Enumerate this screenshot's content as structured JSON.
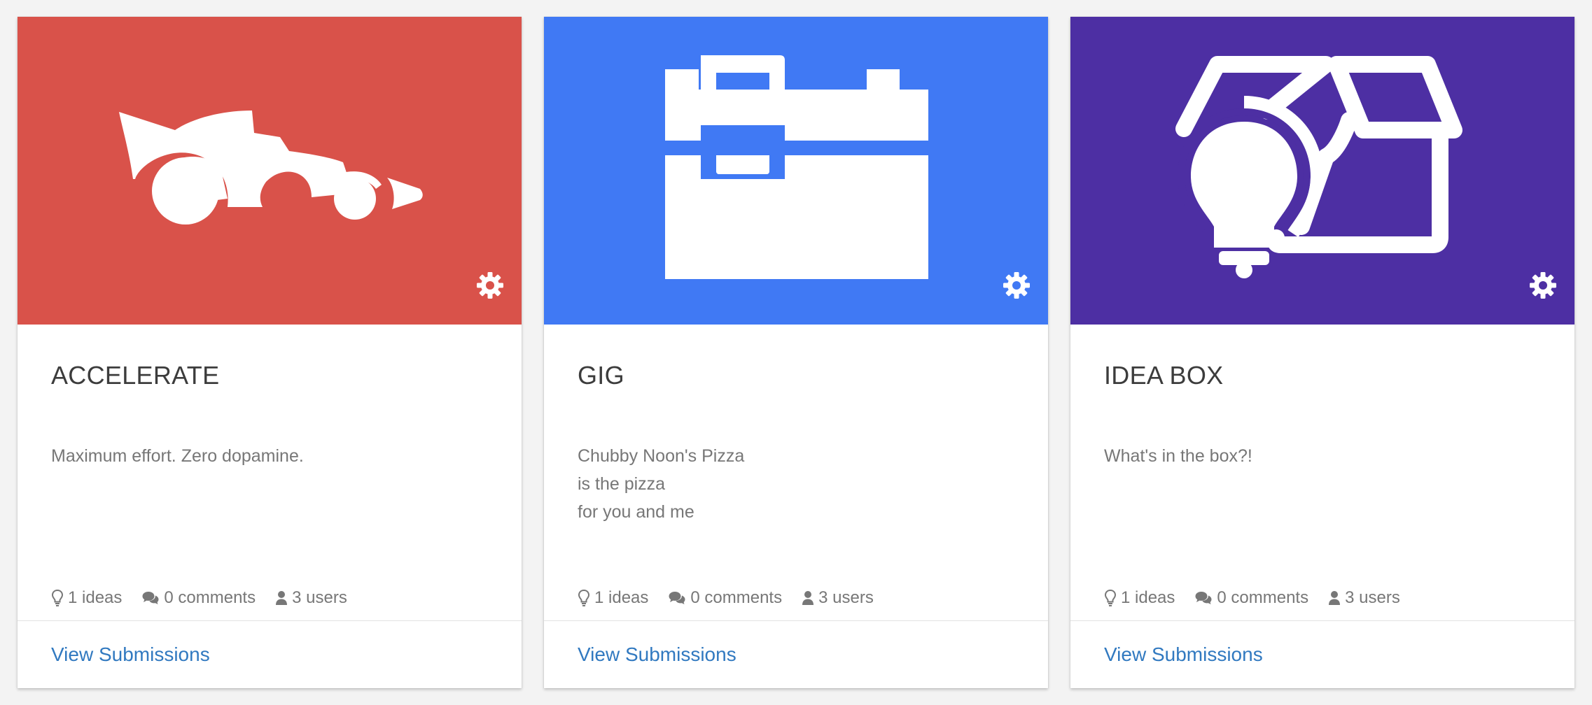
{
  "cards": [
    {
      "title": "ACCELERATE",
      "description": "Maximum effort. Zero dopamine.",
      "ideas": "1 ideas",
      "comments": "0 comments",
      "users": "3 users",
      "link": "View Submissions",
      "banner_color": "#d9524a",
      "banner_icon": "race-car-icon"
    },
    {
      "title": "GIG",
      "description": "Chubby Noon's Pizza\nis the pizza\nfor you and me",
      "ideas": "1 ideas",
      "comments": "0 comments",
      "users": "3 users",
      "link": "View Submissions",
      "banner_color": "#4079f4",
      "banner_icon": "toolbox-icon"
    },
    {
      "title": "IDEA BOX",
      "description": "What's in the box?!",
      "ideas": "1 ideas",
      "comments": "0 comments",
      "users": "3 users",
      "link": "View Submissions",
      "banner_color": "#4d2fa3",
      "banner_icon": "lightbulb-box-icon"
    }
  ],
  "colors": {
    "page_background": "#f3f3f3",
    "title_text": "#3c3c3c",
    "muted_text": "#777777",
    "link": "#3179c0"
  }
}
